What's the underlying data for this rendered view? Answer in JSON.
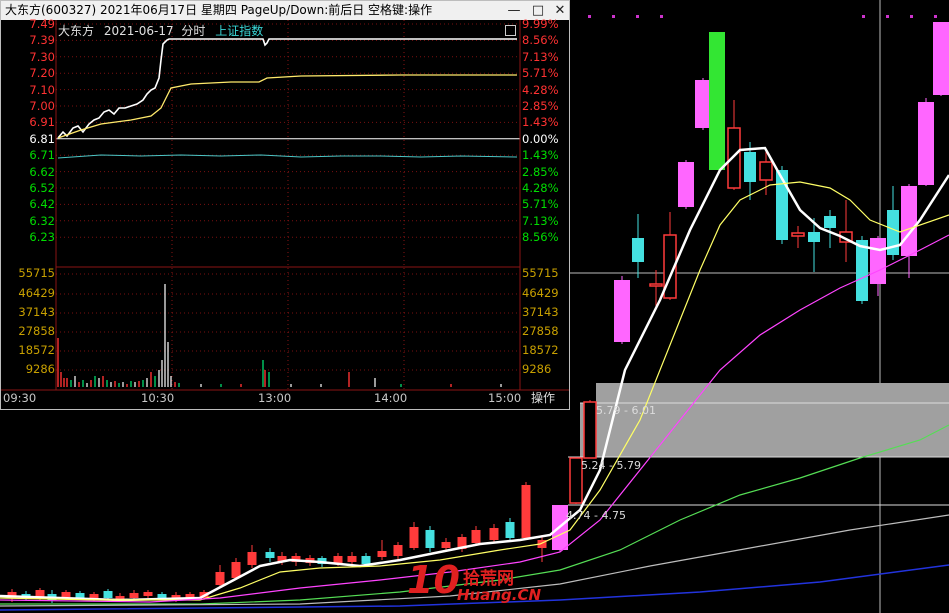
{
  "window": {
    "title": "大东方(600327)  2021年06月17日  星期四  PageUp/Down:前后日  空格键:操作",
    "minimize_glyph": "—",
    "maximize_glyph": "□",
    "close_glyph": "✕"
  },
  "intraday": {
    "stock_name": "大东方",
    "date": "2021-06-17",
    "mode": "分时",
    "index_name": "上证指数",
    "prev_close": 6.81,
    "price_ticks": [
      "7.49",
      "7.39",
      "7.30",
      "7.20",
      "7.10",
      "7.00",
      "6.91",
      "6.81",
      "6.71",
      "6.62",
      "6.52",
      "6.42",
      "6.32",
      "6.23"
    ],
    "pct_ticks": [
      "9.99%",
      "8.56%",
      "7.13%",
      "5.71%",
      "4.28%",
      "2.85%",
      "1.43%",
      "0.00%",
      "1.43%",
      "2.85%",
      "4.28%",
      "5.71%",
      "7.13%",
      "8.56%"
    ],
    "volume_ticks": [
      "55715",
      "46429",
      "37143",
      "27858",
      "18572",
      "9286"
    ],
    "time_labels": [
      "09:30",
      "10:30",
      "13:00",
      "14:00",
      "15:00"
    ],
    "ops_button": "操作",
    "colors": {
      "up": "#ff3232",
      "down": "#00e0e0",
      "flat": "#ffffff",
      "volume_tick": "#c8a000"
    }
  },
  "kline_boxes": [
    {
      "label": "5.79 - 6.01"
    },
    {
      "label": "5.24 - 5.79"
    },
    {
      "label": "4.74 - 4.75"
    }
  ],
  "branding": {
    "logo_number": "10",
    "logo_cn": "拾荒网",
    "logo_url": "Huang.CN"
  },
  "colors": {
    "up_candle": "#ff3b3b",
    "up_big": "#ff66ff",
    "down_candle": "#44e0e0",
    "limit_up": "#33e633",
    "ma5": "#ffffff",
    "ma10": "#ffff66",
    "ma20": "#ff44ff",
    "ma60": "#55dd55",
    "ma120": "#bdbdbd",
    "ma250": "#2233dd"
  }
}
